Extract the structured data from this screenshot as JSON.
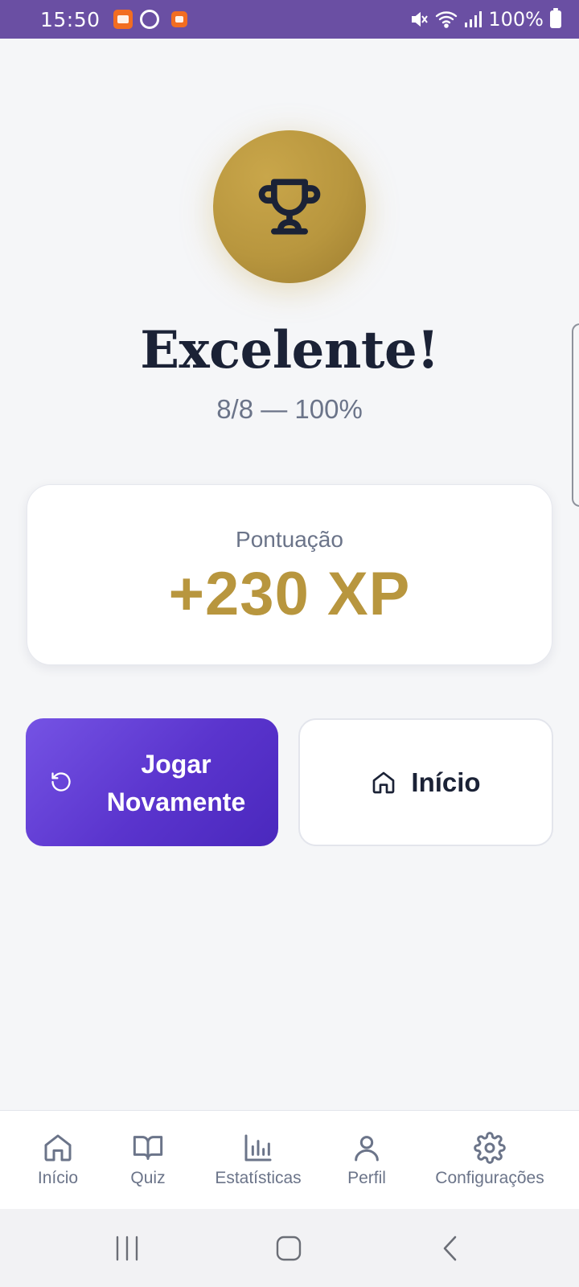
{
  "status_bar": {
    "time": "15:50",
    "battery": "100%",
    "app_icons": [
      "temu-icon",
      "sync-icon",
      "notification-app-icon"
    ],
    "system_icons": [
      "mute-icon",
      "wifi-icon",
      "signal-icon",
      "battery-icon"
    ]
  },
  "result": {
    "icon": "trophy-icon",
    "title": "Excelente!",
    "score_line": "8/8 — 100%"
  },
  "xp_card": {
    "label": "Pontuação",
    "value": "+230 XP"
  },
  "actions": {
    "play_again_label": "Jogar Novamente",
    "play_again_icon": "refresh-icon",
    "home_label": "Início",
    "home_icon": "home-icon"
  },
  "tab_bar": {
    "items": [
      {
        "label": "Início",
        "icon": "home-icon"
      },
      {
        "label": "Quiz",
        "icon": "book-icon"
      },
      {
        "label": "Estatísticas",
        "icon": "bar-chart-icon"
      },
      {
        "label": "Perfil",
        "icon": "user-icon"
      },
      {
        "label": "Configurações",
        "icon": "gear-icon"
      }
    ]
  },
  "system_nav": [
    "recents-button",
    "home-button",
    "back-button"
  ],
  "colors": {
    "accent_purple": "#5a34cd",
    "gold": "#b8963e",
    "text_dark": "#1b2236",
    "text_muted": "#6b7489",
    "status_bar": "#6a4fa3"
  }
}
